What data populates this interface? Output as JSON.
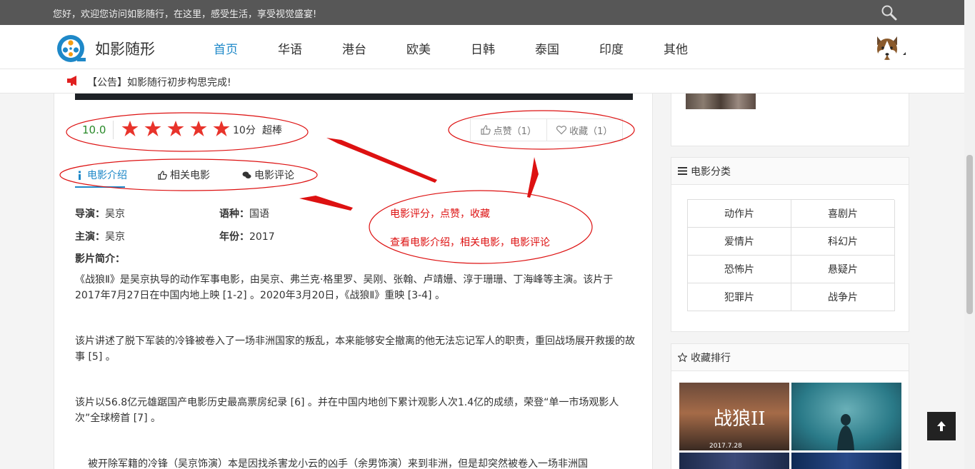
{
  "topbar": {
    "welcome": "您好，欢迎您访问如影随行，在这里，感受生活，享受视觉盛宴!"
  },
  "brand": {
    "name": "如影随形"
  },
  "nav": {
    "items": [
      "首页",
      "华语",
      "港台",
      "欧美",
      "日韩",
      "泰国",
      "印度",
      "其他"
    ],
    "active": "首页"
  },
  "notice": {
    "text": "【公告】如影随行初步构思完成!"
  },
  "rating": {
    "value": "10.0",
    "stars": 5,
    "max_stars": 5,
    "score_text": "10分",
    "word": "超棒"
  },
  "actions": {
    "like_label": "点赞（1）",
    "collect_label": "收藏（1）"
  },
  "tabs": [
    "电影介绍",
    "相关电影",
    "电影评论"
  ],
  "info": {
    "director_label": "导演：",
    "director": "吴京",
    "language_label": "语种：",
    "language": "国语",
    "actor_label": "主演：",
    "actor": "吴京",
    "year_label": "年份：",
    "year": "2017",
    "intro_label": "影片简介："
  },
  "paragraphs": [
    "《战狼Ⅱ》是吴京执导的动作军事电影，由吴京、弗兰克·格里罗、吴刚、张翰、卢靖姗、淳于珊珊、丁海峰等主演。该片于2017年7月27日在中国内地上映 [1-2] 。2020年3月20日，《战狼Ⅱ》重映 [3-4] 。",
    "该片讲述了脱下军装的冷锋被卷入了一场非洲国家的叛乱，本来能够安全撤离的他无法忘记军人的职责，重回战场展开救援的故事 [5] 。",
    "该片以56.8亿元雄踞国产电影历史最高票房纪录 [6] 。并在中国内地创下累计观影人次1.4亿的成绩，荣登“单一市场观影人次”全球榜首 [7] 。",
    "被开除军籍的冷锋（吴京饰演）本是因找杀害龙小云的凶手（余男饰演）来到非洲，但是却突然被卷入一场非洲国"
  ],
  "annotations": {
    "line1": "电影评分，点赞，收藏",
    "line2": "查看电影介绍，相关电影，电影评论"
  },
  "sidebar": {
    "categories_title": "电影分类",
    "categories": [
      "动作片",
      "喜剧片",
      "爱情片",
      "科幻片",
      "恐怖片",
      "悬疑片",
      "犯罪片",
      "战争片"
    ],
    "ranking_title": "收藏排行",
    "poster1_title": "战狼II",
    "poster1_date": "2017.7.28"
  },
  "colors": {
    "accent": "#1e88c8",
    "annotation": "#dd1111",
    "star": "#e8332b",
    "rating": "#2a8a2a"
  }
}
